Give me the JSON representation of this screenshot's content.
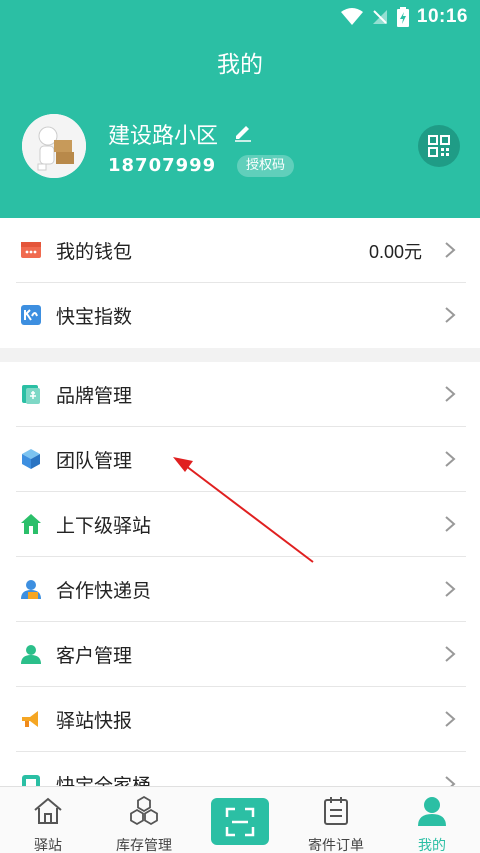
{
  "status": {
    "time": "10:16"
  },
  "header": {
    "title": "我的",
    "profile_name": "建设路小区",
    "phone": "18707999",
    "auth_badge": "授权码"
  },
  "wallet": {
    "label": "我的钱包",
    "value": "0.00元"
  },
  "index": {
    "label": "快宝指数"
  },
  "menu": [
    {
      "label": "品牌管理"
    },
    {
      "label": "团队管理"
    },
    {
      "label": "上下级驿站"
    },
    {
      "label": "合作快递员"
    },
    {
      "label": "客户管理"
    },
    {
      "label": "驿站快报"
    },
    {
      "label": "快宝全家桶"
    }
  ],
  "tabs": [
    {
      "label": "驿站"
    },
    {
      "label": "库存管理"
    },
    {
      "label": ""
    },
    {
      "label": "寄件订单"
    },
    {
      "label": "我的"
    }
  ],
  "colors": {
    "primary": "#2bbfa4",
    "arrow": "#e02020"
  }
}
